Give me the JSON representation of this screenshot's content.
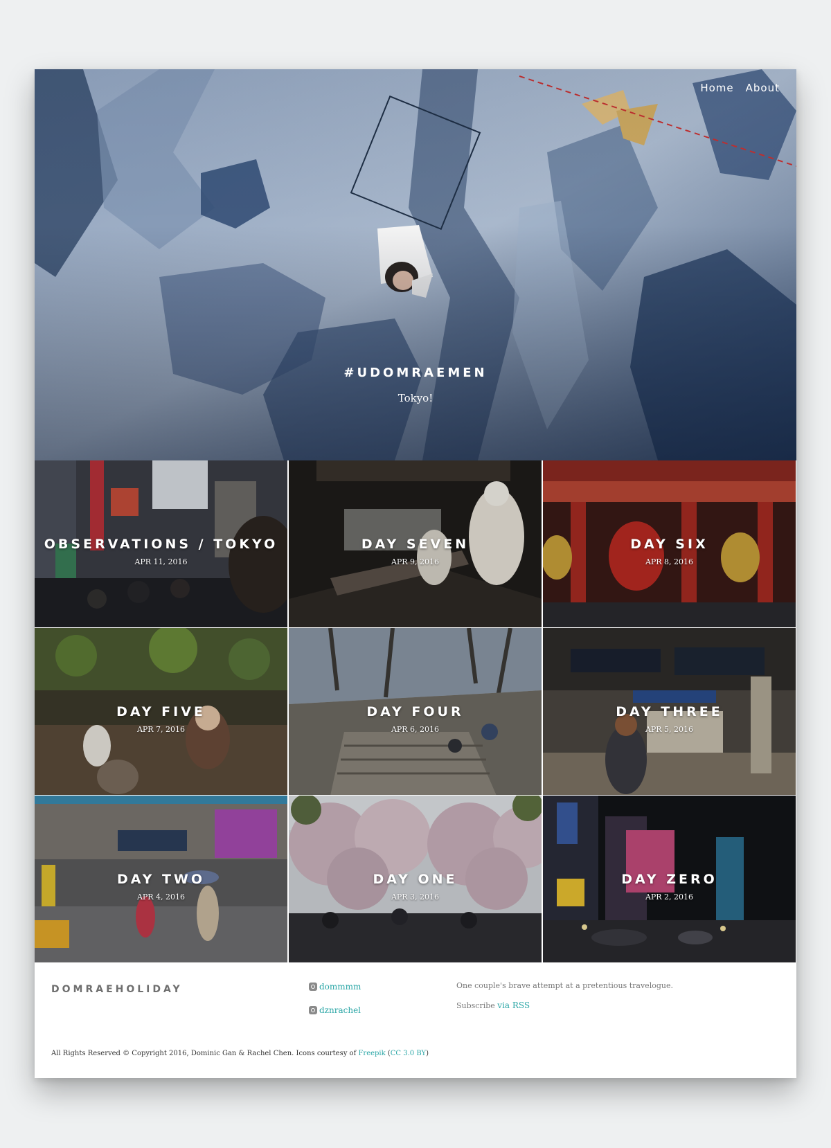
{
  "nav": {
    "home": "Home",
    "about": "About"
  },
  "hero": {
    "title": "#UDOMRAEMEN",
    "subtitle": "Tokyo!"
  },
  "posts": [
    {
      "title": "OBSERVATIONS / TOKYO",
      "date": "APR 11, 2016"
    },
    {
      "title": "DAY SEVEN",
      "date": "APR 9, 2016"
    },
    {
      "title": "DAY SIX",
      "date": "APR 8, 2016"
    },
    {
      "title": "DAY FIVE",
      "date": "APR 7, 2016"
    },
    {
      "title": "DAY FOUR",
      "date": "APR 6, 2016"
    },
    {
      "title": "DAY THREE",
      "date": "APR 5, 2016"
    },
    {
      "title": "DAY TWO",
      "date": "APR 4, 2016"
    },
    {
      "title": "DAY ONE",
      "date": "APR 3, 2016"
    },
    {
      "title": "DAY ZERO",
      "date": "APR 2, 2016"
    }
  ],
  "footer": {
    "brand": "DOMRAEHOLIDAY",
    "social": [
      {
        "icon": "instagram-icon",
        "handle": "dommmm"
      },
      {
        "icon": "instagram-icon",
        "handle": "dznrachel"
      }
    ],
    "tagline": "One couple's brave attempt at a pretentious travelogue.",
    "subscribe_prefix": "Subscribe ",
    "subscribe_link": "via RSS",
    "copyright_prefix": "All Rights Reserved © Copyright 2016, Dominic Gan & Rachel Chen. Icons courtesy of ",
    "freepik": "Freepik",
    "paren_open": " (",
    "license": "CC 3.0 BY",
    "paren_close": ")"
  },
  "colors": {
    "link": "#2aa6a6",
    "brand_text": "#6f6f6f",
    "page_bg": "#eef0f1"
  }
}
